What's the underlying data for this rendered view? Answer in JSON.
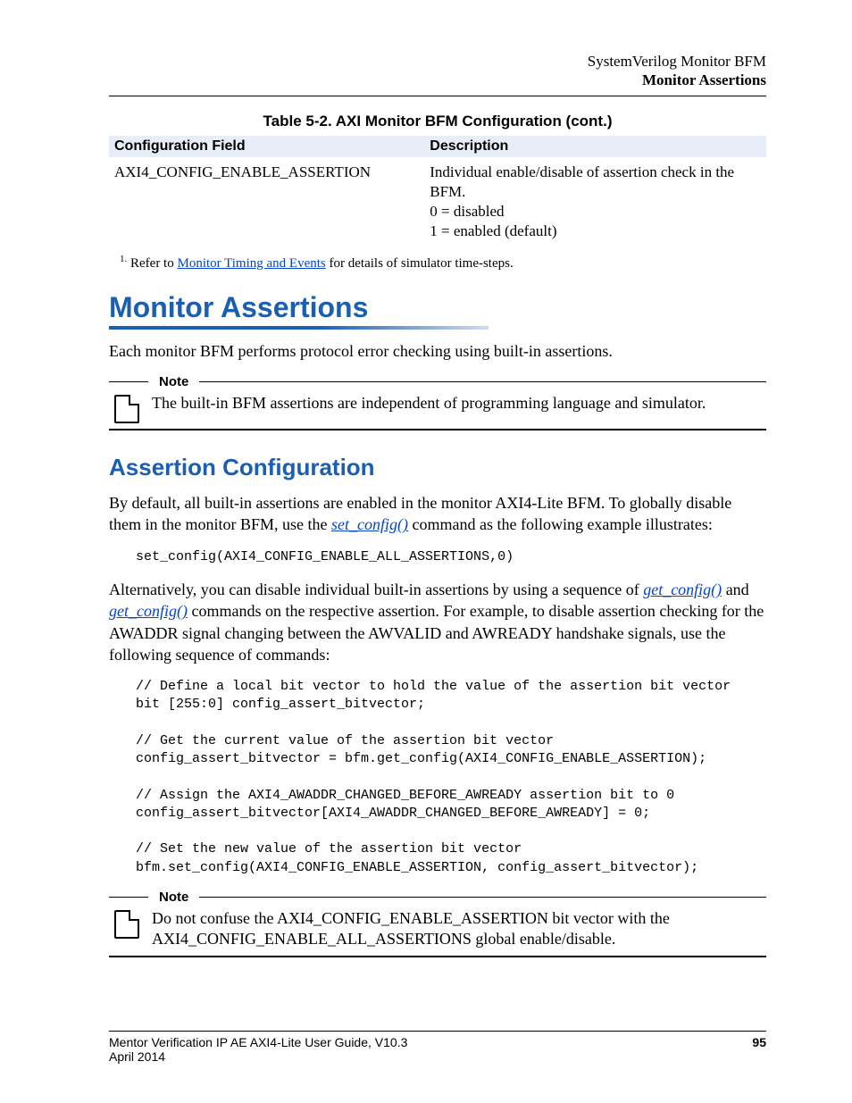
{
  "header": {
    "line1": "SystemVerilog Monitor BFM",
    "line2": "Monitor Assertions"
  },
  "table": {
    "caption": "Table 5-2. AXI Monitor BFM Configuration (cont.)",
    "col1": "Configuration Field",
    "col2": "Description",
    "row": {
      "field": "AXI4_CONFIG_ENABLE_ASSERTION",
      "desc_l1": "Individual enable/disable of assertion check in the BFM.",
      "desc_l2": "0 = disabled",
      "desc_l3": "1 = enabled (default)"
    }
  },
  "footnote": {
    "marker": "1.",
    "pre": " Refer to ",
    "link": "Monitor Timing and Events",
    "post": " for details of simulator time-steps."
  },
  "section": {
    "title": "Monitor Assertions",
    "intro": "Each monitor BFM performs protocol error checking using built-in assertions."
  },
  "note1": {
    "label": "Note",
    "text": "The built-in BFM assertions are independent of programming language and simulator."
  },
  "subsection": {
    "title": "Assertion Configuration",
    "p1_pre": "By default, all built-in assertions are enabled in the monitor AXI4-Lite BFM. To globally disable them in the monitor BFM, use the ",
    "p1_link": "set_config()",
    "p1_post": " command as the following example illustrates:",
    "code1": "set_config(AXI4_CONFIG_ENABLE_ALL_ASSERTIONS,0)",
    "p2_pre": "Alternatively, you can disable individual built-in assertions by using a sequence of ",
    "p2_link1": "get_config()",
    "p2_mid": " and ",
    "p2_link2": "get_config()",
    "p2_post": " commands on the respective assertion. For example, to disable assertion checking for the AWADDR signal changing between the AWVALID and AWREADY handshake signals, use the following sequence of commands:",
    "code2": "// Define a local bit vector to hold the value of the assertion bit vector\nbit [255:0] config_assert_bitvector;\n\n// Get the current value of the assertion bit vector\nconfig_assert_bitvector = bfm.get_config(AXI4_CONFIG_ENABLE_ASSERTION);\n\n// Assign the AXI4_AWADDR_CHANGED_BEFORE_AWREADY assertion bit to 0\nconfig_assert_bitvector[AXI4_AWADDR_CHANGED_BEFORE_AWREADY] = 0;\n\n// Set the new value of the assertion bit vector\nbfm.set_config(AXI4_CONFIG_ENABLE_ASSERTION, config_assert_bitvector);"
  },
  "note2": {
    "label": "Note",
    "text": "Do not confuse the AXI4_CONFIG_ENABLE_ASSERTION bit vector with the AXI4_CONFIG_ENABLE_ALL_ASSERTIONS global enable/disable."
  },
  "footer": {
    "title": "Mentor Verification IP AE AXI4-Lite User Guide, V10.3",
    "date": "April 2014",
    "page": "95"
  }
}
